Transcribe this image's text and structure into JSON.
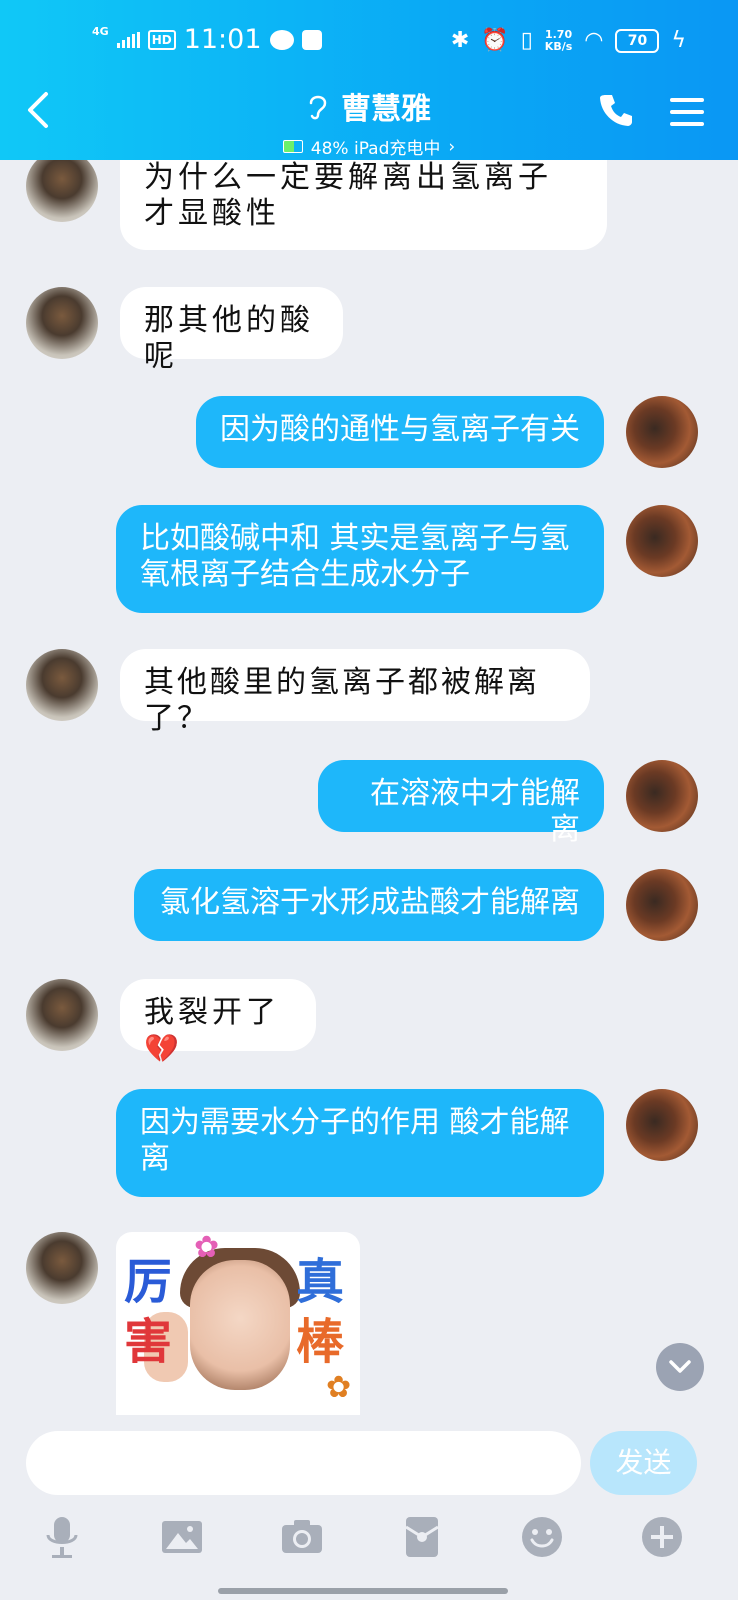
{
  "status_bar": {
    "network": "4G",
    "hd": "HD",
    "time": "11:01",
    "speed_value": "1.70",
    "speed_unit": "KB/s",
    "battery": "70"
  },
  "header": {
    "back_icon": "chevron-left-icon",
    "contact_name": "曹慧雅",
    "device_status": "48% iPad充电中",
    "chevron": "›",
    "call_icon": "phone-icon",
    "menu_icon": "menu-icon"
  },
  "messages": [
    {
      "side": "in",
      "text": "为什么一定要解离出氢离子才显酸性"
    },
    {
      "side": "in",
      "text": "那其他的酸呢"
    },
    {
      "side": "out",
      "text": "因为酸的通性与氢离子有关"
    },
    {
      "side": "out",
      "text": "比如酸碱中和 其实是氢离子与氢氧根离子结合生成水分子"
    },
    {
      "side": "in",
      "text": "其他酸里的氢离子都被解离了？"
    },
    {
      "side": "out",
      "text": "在溶液中才能解离"
    },
    {
      "side": "out",
      "text": "氯化氢溶于水形成盐酸才能解离"
    },
    {
      "side": "in",
      "text": "我裂开了",
      "emoji": "💔"
    },
    {
      "side": "out",
      "text": "因为需要水分子的作用 酸才能解离"
    },
    {
      "side": "in",
      "sticker_chars": [
        "厉",
        "害",
        "真",
        "棒"
      ]
    }
  ],
  "scroll_down_icon": "chevron-down-icon",
  "composer": {
    "input_value": "",
    "send_label": "发送"
  },
  "toolbar_icons": [
    "microphone-icon",
    "image-icon",
    "camera-icon",
    "red-packet-icon",
    "emoji-icon",
    "plus-icon"
  ],
  "colors": {
    "header_start": "#10c8f7",
    "header_end": "#0a97f4",
    "outgoing_bubble": "#1eb7fa",
    "incoming_bubble": "#ffffff",
    "background": "#eceef3"
  }
}
